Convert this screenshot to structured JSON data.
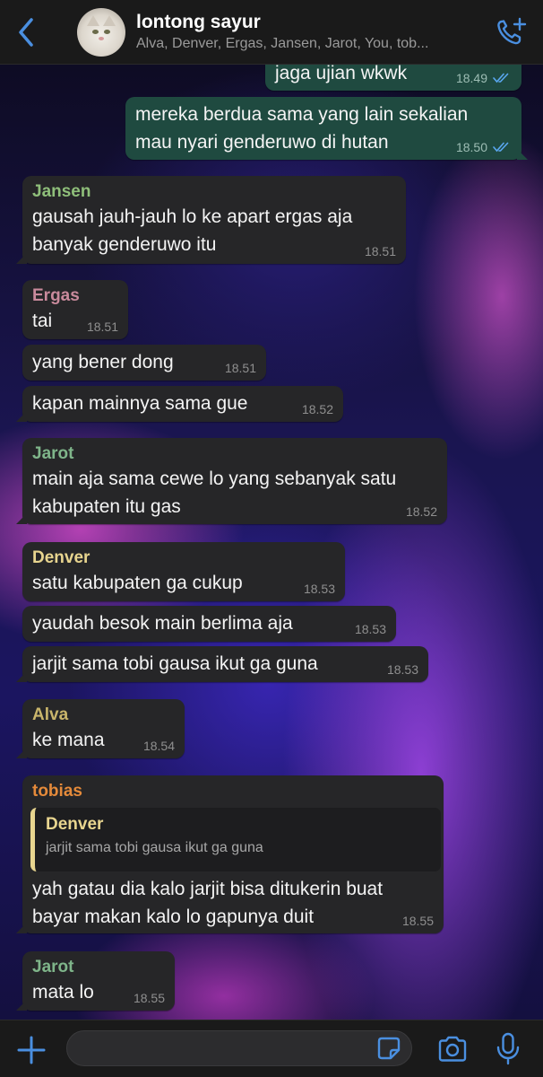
{
  "header": {
    "title": "lontong sayur",
    "members": "Alva, Denver, Ergas, Jansen, Jarot, You, tob..."
  },
  "messages": [
    {
      "text": "jaga ujian wkwk",
      "time": "18.49"
    },
    {
      "line1": "mereka berdua sama yang lain sekalian",
      "line2": "mau nyari genderuwo di hutan",
      "time": "18.50"
    },
    {
      "sender": "Jansen",
      "line1": "gausah jauh-jauh lo ke apart ergas aja",
      "line2": "banyak genderuwo itu",
      "time": "18.51"
    },
    {
      "sender": "Ergas",
      "text": "tai",
      "time": "18.51"
    },
    {
      "text": "yang bener dong",
      "time": "18.51"
    },
    {
      "text": "kapan mainnya sama gue",
      "time": "18.52"
    },
    {
      "sender": "Jarot",
      "line1": "main aja sama cewe lo yang sebanyak satu",
      "line2": "kabupaten itu gas",
      "time": "18.52"
    },
    {
      "sender": "Denver",
      "text": "satu kabupaten ga cukup",
      "time": "18.53"
    },
    {
      "text": "yaudah besok main berlima aja",
      "time": "18.53"
    },
    {
      "text": "jarjit sama tobi gausa ikut ga guna",
      "time": "18.53"
    },
    {
      "sender": "Alva",
      "text": "ke mana",
      "time": "18.54"
    },
    {
      "sender": "tobias",
      "quote_sender": "Denver",
      "quote_text": "jarjit sama tobi gausa ikut ga guna",
      "line1": "yah gatau dia kalo jarjit bisa ditukerin buat",
      "line2": "bayar makan kalo lo gapunya duit",
      "time": "18.55"
    },
    {
      "sender": "Jarot",
      "text": "mata lo",
      "time": "18.55"
    }
  ],
  "colors": {
    "jansen": "#8fbf7a",
    "ergas": "#c98a9c",
    "jarot": "#7fb58a",
    "denver": "#e8d58f",
    "alva": "#c9b56b",
    "tobias": "#e58a3a",
    "accent": "#4a8fe0"
  },
  "composer": {
    "placeholder": ""
  },
  "icons": [
    "back-chevron-icon",
    "add-call-icon",
    "read-ticks-icon",
    "plus-icon",
    "sticker-icon",
    "camera-icon",
    "mic-icon"
  ]
}
